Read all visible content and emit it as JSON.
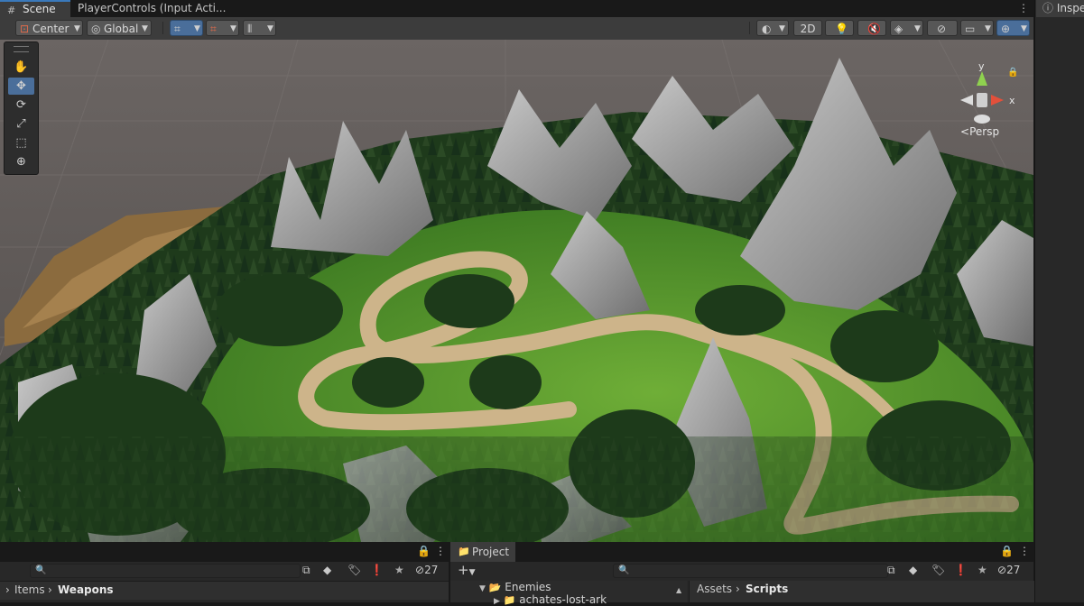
{
  "tabs": {
    "scene": "Scene",
    "player_controls": "PlayerControls (Input Acti...",
    "inspector": "Inspe"
  },
  "toolbar": {
    "pivot_label": "Center",
    "space_label": "Global"
  },
  "scene_view": {
    "button_2d": "2D",
    "perspective_label": "Persp",
    "gizmo_axes": {
      "y": "y",
      "x": "x"
    }
  },
  "bottom_left": {
    "hidden_count": "27",
    "breadcrumb": {
      "parent": "Items",
      "current": "Weapons"
    }
  },
  "project_panel": {
    "tab_label": "Project",
    "hidden_count": "27",
    "tree": [
      {
        "label": "Enemies"
      },
      {
        "label": "achates-lost-ark"
      }
    ],
    "breadcrumb": {
      "root": "Assets",
      "current": "Scripts"
    }
  },
  "colors": {
    "accent": "#4a6e9a",
    "terrain_grass": "#5c9a2f",
    "path": "#cdb48a",
    "rock": "#9a9a9a",
    "tree": "#1f3a1c",
    "background": "#5e5a58"
  }
}
